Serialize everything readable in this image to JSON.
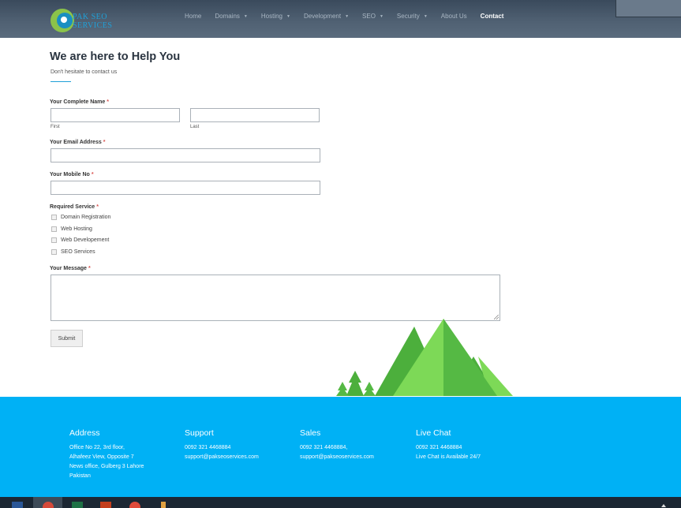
{
  "header": {
    "logo": {
      "line1": "PAK SEO",
      "line2": "SERVICES"
    },
    "nav": [
      {
        "label": "Home",
        "dropdown": false,
        "active": false
      },
      {
        "label": "Domains",
        "dropdown": true,
        "active": false
      },
      {
        "label": "Hosting",
        "dropdown": true,
        "active": false
      },
      {
        "label": "Development",
        "dropdown": true,
        "active": false
      },
      {
        "label": "SEO",
        "dropdown": true,
        "active": false
      },
      {
        "label": "Security",
        "dropdown": true,
        "active": false
      },
      {
        "label": "About Us",
        "dropdown": false,
        "active": false
      },
      {
        "label": "Contact",
        "dropdown": false,
        "active": true
      }
    ]
  },
  "page": {
    "title": "We are here to Help You",
    "subtitle": "Don't hesitate to contact us"
  },
  "form": {
    "required_mark": "*",
    "name": {
      "label": "Your Complete Name",
      "first_hint": "First",
      "last_hint": "Last",
      "first_value": "",
      "last_value": ""
    },
    "email": {
      "label": "Your Email Address",
      "value": ""
    },
    "mobile": {
      "label": "Your Mobile No",
      "value": ""
    },
    "service": {
      "label": "Required Service",
      "options": [
        "Domain Registration",
        "Web Hosting",
        "Web Developement",
        "SEO Services"
      ]
    },
    "message": {
      "label": "Your Message",
      "value": ""
    },
    "submit_label": "Submit"
  },
  "footer": {
    "columns": [
      {
        "heading": "Address",
        "lines": [
          "Office No 22, 3rd floor,",
          "Alhafeez View, Opposite 7",
          "News office, Gulberg 3 Lahore",
          "Pakistan"
        ]
      },
      {
        "heading": "Support",
        "lines": [
          "0092 321 4468884",
          "support@pakseoservices.com"
        ]
      },
      {
        "heading": "Sales",
        "lines": [
          "0092 321 4468884,",
          "support@pakseoservices.com"
        ]
      },
      {
        "heading": "Live Chat",
        "lines": [
          "0092 321 4468884",
          "Live Chat is Available 24/7"
        ]
      }
    ]
  },
  "taskbar": {
    "icons": [
      "word-icon",
      "chrome-icon",
      "excel-icon",
      "powerpoint-icon",
      "media-icon",
      "pencil-icon"
    ]
  },
  "colors": {
    "accent": "#00b1f5",
    "header_bg": "#4f6072",
    "required": "#d9534f",
    "mountain_dark": "#4caf3c",
    "mountain_light": "#7dd957"
  }
}
